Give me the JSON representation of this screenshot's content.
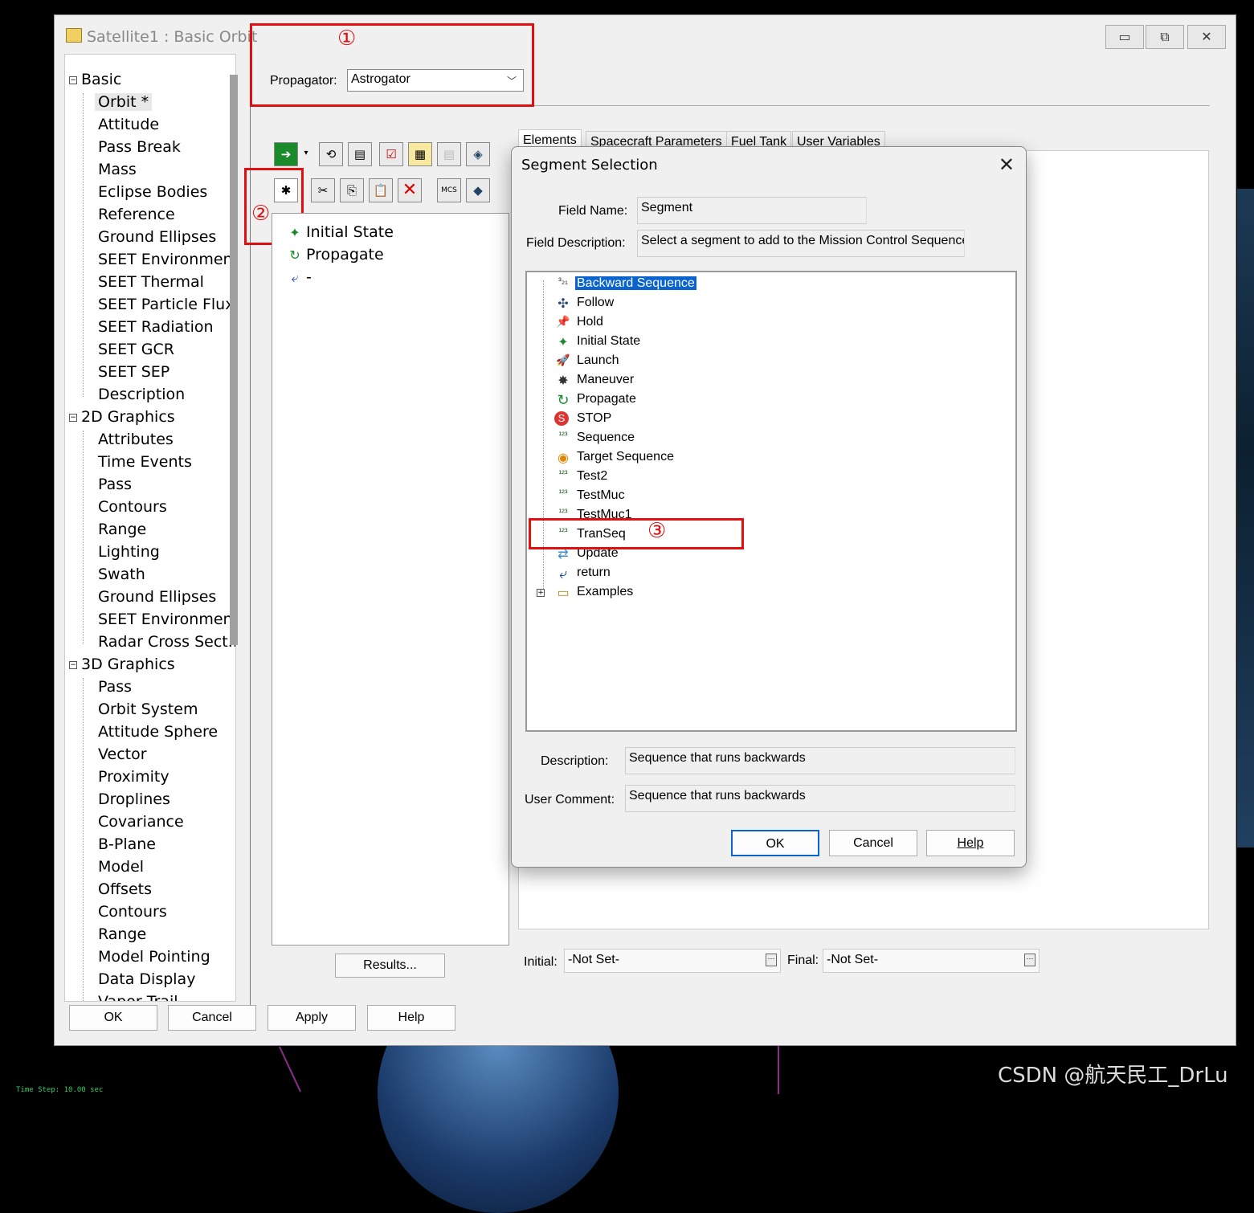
{
  "window": {
    "title": "Satellite1 : Basic Orbit",
    "min_glyph": "▭",
    "max_glyph": "⧉",
    "close_glyph": "✕"
  },
  "tree": {
    "groups": [
      {
        "label": "Basic",
        "items": [
          "Orbit *",
          "Attitude",
          "Pass Break",
          "Mass",
          "Eclipse Bodies",
          "Reference",
          "Ground Ellipses",
          "SEET Environment",
          "SEET Thermal",
          "SEET Particle Flux",
          "SEET Radiation",
          "SEET GCR",
          "SEET SEP",
          "Description"
        ]
      },
      {
        "label": "2D Graphics",
        "items": [
          "Attributes",
          "Time Events",
          "Pass",
          "Contours",
          "Range",
          "Lighting",
          "Swath",
          "Ground Ellipses",
          "SEET Environment",
          "Radar Cross Sect..."
        ]
      },
      {
        "label": "3D Graphics",
        "items": [
          "Pass",
          "Orbit System",
          "Attitude Sphere",
          "Vector",
          "Proximity",
          "Droplines",
          "Covariance",
          "B-Plane",
          "Model",
          "Offsets",
          "Contours",
          "Range",
          "Model Pointing",
          "Data Display",
          "Vapor Trail"
        ]
      }
    ],
    "expander": "−"
  },
  "propagator": {
    "label": "Propagator:",
    "value": "Astrogator"
  },
  "annotations": {
    "one": "①",
    "two": "②",
    "three": "③"
  },
  "mcs": {
    "items": [
      {
        "label": "Initial State",
        "icon": "initial-state-icon"
      },
      {
        "label": "Propagate",
        "icon": "propagate-icon"
      },
      {
        "label": "-",
        "icon": "return-icon"
      }
    ],
    "results_label": "Results..."
  },
  "tabs": [
    "Elements",
    "Spacecraft Parameters",
    "Fuel Tank",
    "User Variables"
  ],
  "initial_final": {
    "initial_label": "Initial:",
    "initial_value": "-Not Set-",
    "final_label": "Final:",
    "final_value": "-Not Set-"
  },
  "bottom_buttons": {
    "ok": "OK",
    "cancel": "Cancel",
    "apply": "Apply",
    "help": "Help"
  },
  "dialog": {
    "title": "Segment Selection",
    "field_name_label": "Field Name:",
    "field_name_value": "Segment",
    "field_desc_label": "Field Description:",
    "field_desc_value": "Select a segment to add to the Mission Control Sequence",
    "segments": [
      {
        "label": "Backward Sequence",
        "icon": "backward-sequence-icon",
        "selected": true
      },
      {
        "label": "Follow",
        "icon": "follow-icon"
      },
      {
        "label": "Hold",
        "icon": "hold-icon"
      },
      {
        "label": "Initial State",
        "icon": "initial-state-icon"
      },
      {
        "label": "Launch",
        "icon": "launch-icon"
      },
      {
        "label": "Maneuver",
        "icon": "maneuver-icon"
      },
      {
        "label": "Propagate",
        "icon": "propagate-icon"
      },
      {
        "label": "STOP",
        "icon": "stop-icon"
      },
      {
        "label": "Sequence",
        "icon": "sequence-icon"
      },
      {
        "label": "Target Sequence",
        "icon": "target-sequence-icon"
      },
      {
        "label": "Test2",
        "icon": "sequence-icon"
      },
      {
        "label": "TestMuc",
        "icon": "sequence-icon"
      },
      {
        "label": "TestMuc1",
        "icon": "sequence-icon"
      },
      {
        "label": "TranSeq",
        "icon": "sequence-icon"
      },
      {
        "label": "Update",
        "icon": "update-icon"
      },
      {
        "label": "return",
        "icon": "return-icon"
      },
      {
        "label": "Examples",
        "icon": "folder-icon"
      }
    ],
    "description_label": "Description:",
    "description_value": "Sequence that runs backwards",
    "comment_label": "User Comment:",
    "comment_value": "Sequence that runs backwards",
    "ok": "OK",
    "cancel": "Cancel",
    "help": "Help"
  },
  "status": {
    "time_step": "Time Step: 10.00 sec"
  },
  "watermark": "CSDN @航天民工_DrLu"
}
